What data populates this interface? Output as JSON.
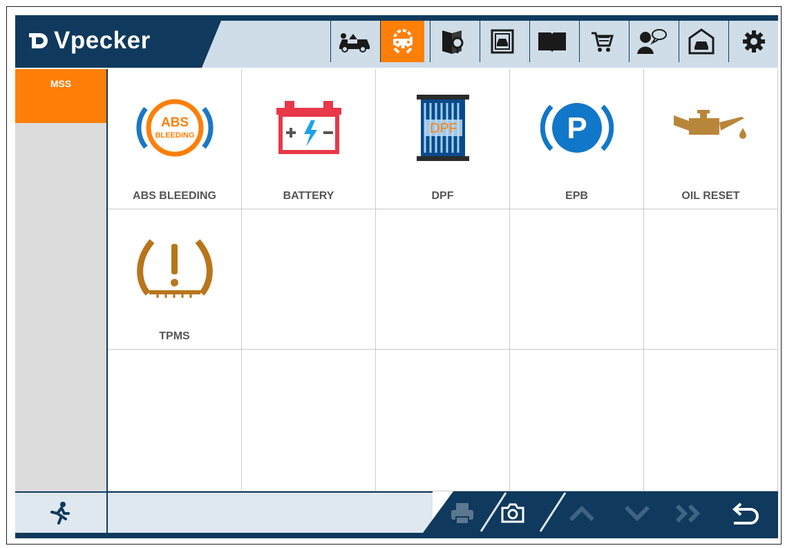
{
  "app": {
    "brand": "Vpecker"
  },
  "toolbar": {
    "items": [
      {
        "name": "car-diagnosis-icon",
        "active": false
      },
      {
        "name": "special-function-icon",
        "active": true
      },
      {
        "name": "report-search-icon",
        "active": false
      },
      {
        "name": "data-playback-icon",
        "active": false
      },
      {
        "name": "manual-book-icon",
        "active": false
      },
      {
        "name": "shop-cart-icon",
        "active": false
      },
      {
        "name": "user-feedback-icon",
        "active": false
      },
      {
        "name": "garage-icon",
        "active": false
      },
      {
        "name": "settings-gear-icon",
        "active": false
      }
    ]
  },
  "sidebar": {
    "items": [
      {
        "label": "MSS",
        "active": true
      }
    ]
  },
  "functions": [
    {
      "label": "ABS BLEEDING",
      "icon": "abs-bleeding-icon",
      "icon_text": "ABS",
      "icon_subtext": "BLEEDING"
    },
    {
      "label": "BATTERY",
      "icon": "battery-icon"
    },
    {
      "label": "DPF",
      "icon": "dpf-icon",
      "icon_text": "DPF"
    },
    {
      "label": "EPB",
      "icon": "epb-parking-brake-icon",
      "icon_text": "P"
    },
    {
      "label": "OIL RESET",
      "icon": "oil-can-icon"
    },
    {
      "label": "TPMS",
      "icon": "tpms-tire-icon"
    }
  ],
  "footer": {
    "buttons": [
      "exit-run-icon",
      "print-icon",
      "camera-icon",
      "page-up-icon",
      "page-down-icon",
      "fast-forward-icon",
      "back-icon"
    ]
  },
  "colors": {
    "navy": "#0f3a5d",
    "accent": "#ff7f08",
    "light": "#cfdde8",
    "blue": "#1177c8",
    "gold": "#b8863a"
  }
}
